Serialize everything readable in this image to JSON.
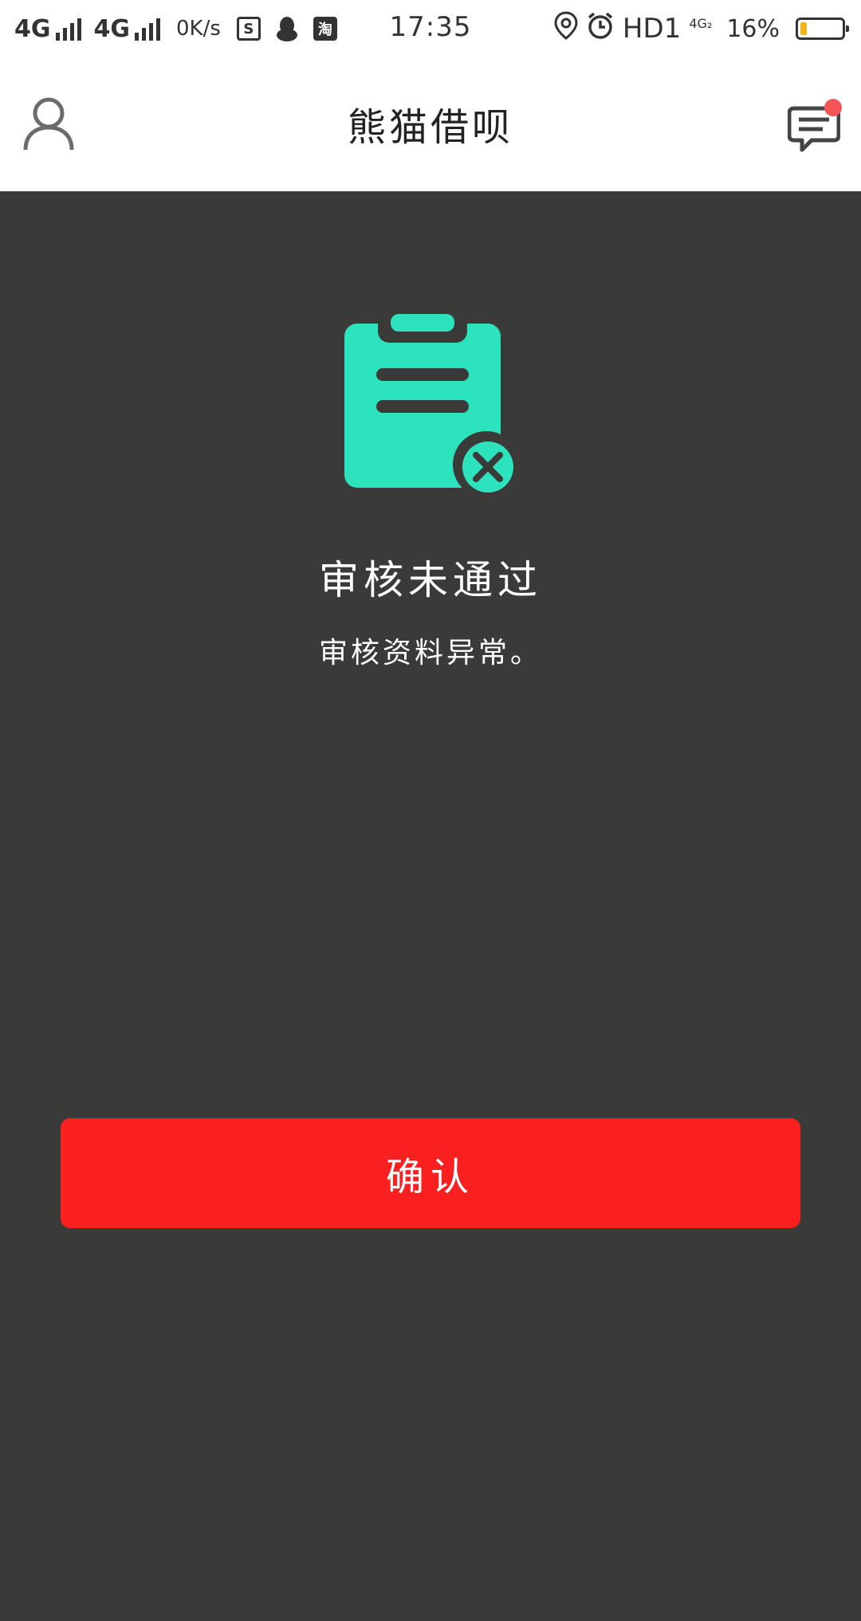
{
  "status_bar": {
    "network_1": "4G",
    "network_2": "4G",
    "net_speed": "0K/s",
    "app_icon_1": "S",
    "app_icon_3": "淘",
    "time": "17:35",
    "hd_label": "HD1",
    "network_3": "4G₂",
    "battery_percent": "16%",
    "battery_level": 0.16,
    "battery_color": "#f2b519"
  },
  "nav": {
    "title": "熊猫借呗",
    "left_icon": "user-icon",
    "right_icon": "message-icon",
    "badge_color": "#f35454"
  },
  "result": {
    "icon": "clipboard-rejected-icon",
    "accent_color": "#2de3be",
    "title": "审核未通过",
    "description": "审核资料异常。"
  },
  "actions": {
    "confirm_label": "确认",
    "confirm_color": "#fb2020"
  }
}
